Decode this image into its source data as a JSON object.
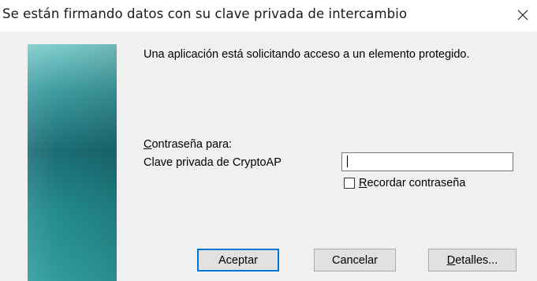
{
  "dialog": {
    "title": "Se están firmando datos con su clave privada de intercambio",
    "close_icon": "close-icon",
    "message": "Una aplicación está solicitando acceso a un elemento protegido.",
    "password_label_first": "C",
    "password_label_rest": "ontraseña para:",
    "key_name": "Clave privada de CryptoAP",
    "password_value": "",
    "remember_first": "R",
    "remember_rest": "ecordar contraseña",
    "remember_checked": false,
    "buttons": {
      "ok": "Aceptar",
      "cancel": "Cancelar",
      "details_first": "D",
      "details_rest": "etalles..."
    },
    "accent_color": "#0078d7",
    "banner_color": "#1a6c74"
  }
}
